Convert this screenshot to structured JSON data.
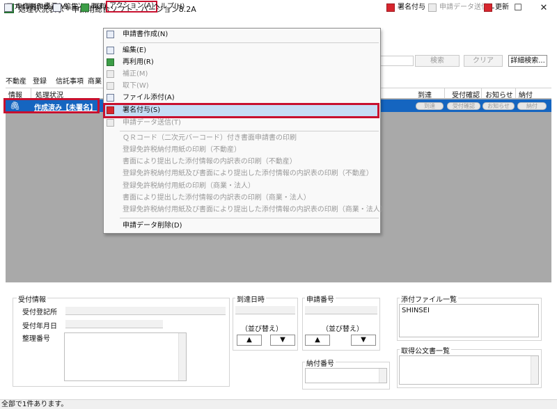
{
  "window": {
    "title": "処理状況表示 - 申請用総合ソフト - バージョン8.2A",
    "minimize": "—",
    "maximize": "☐",
    "close": "✕"
  },
  "menubar": [
    "ファイル(F)",
    "表示(V)",
    "ツール(T)",
    "アクション(A)",
    "ヘルプ(H)"
  ],
  "toolbar": {
    "left": [
      "申請書作成",
      "編集",
      "再利"
    ],
    "right": [
      "署名付与",
      "申請データ送信",
      "更新"
    ]
  },
  "search": {
    "search_label": "検索",
    "clear_label": "クリア",
    "detail_label": "詳細検索..."
  },
  "tabs": [
    "不動産",
    "登録",
    "信託事項",
    "商業・"
  ],
  "grid": {
    "columns_left": [
      "情報",
      "処理状況"
    ],
    "columns_right": [
      "到達",
      "受付確認",
      "お知らせ",
      "納付"
    ],
    "row": {
      "status": "作成済み【未署名】",
      "pills": [
        "到達",
        "受付確認",
        "お知らせ",
        "納付"
      ]
    }
  },
  "action_menu": {
    "items": [
      {
        "label": "申請書作成(N)",
        "enabled": true
      },
      {
        "label": "編集(E)",
        "enabled": true
      },
      {
        "label": "再利用(R)",
        "enabled": true
      },
      {
        "label": "補正(M)",
        "enabled": false
      },
      {
        "label": "取下(W)",
        "enabled": false
      },
      {
        "label": "ファイル添付(A)",
        "enabled": true
      },
      {
        "label": "署名付与(S)",
        "enabled": true,
        "selected": true
      },
      {
        "label": "申請データ送信(T)",
        "enabled": false
      },
      {
        "label": "ＱＲコード（二次元バーコード）付き書面申請書の印刷",
        "enabled": false
      },
      {
        "label": "登録免許税納付用紙の印刷（不動産）",
        "enabled": false
      },
      {
        "label": "書面により提出した添付情報の内訳表の印刷（不動産）",
        "enabled": false
      },
      {
        "label": "登録免許税納付用紙及び書面により提出した添付情報の内訳表の印刷（不動産）",
        "enabled": false
      },
      {
        "label": "登録免許税納付用紙の印刷（商業・法人）",
        "enabled": false
      },
      {
        "label": "書面により提出した添付情報の内訳表の印刷（商業・法人）",
        "enabled": false
      },
      {
        "label": "登録免許税納付用紙及び書面により提出した添付情報の内訳表の印刷（商業・法人）",
        "enabled": false
      },
      {
        "label": "申請データ削除(D)",
        "enabled": true
      }
    ]
  },
  "bottom": {
    "receipt_info": "受付情報",
    "receipt_office": "受付登記所",
    "receipt_date": "受付年月日",
    "ref_number": "整理番号",
    "arrival_datetime": "到達日時",
    "application_number": "申請番号",
    "sort_label": "（並び替え）",
    "sort_up": "▲",
    "sort_down": "▼",
    "payment_number": "納付番号",
    "attachment_list": "添付ファイル一覧",
    "attachment_item": "SHINSEI",
    "official_docs": "取得公文書一覧"
  },
  "status_bar": {
    "text": "全部で1件あります。"
  },
  "colors": {
    "selection": "#1565c0",
    "highlight": "#c8102e",
    "menu_hover": "#c6ddf5"
  }
}
